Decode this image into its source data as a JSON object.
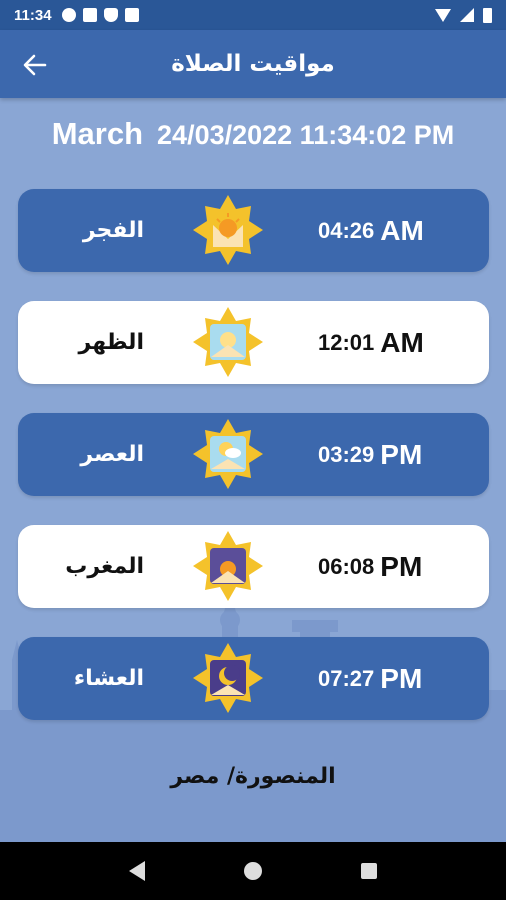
{
  "status_bar": {
    "time": "11:34"
  },
  "header": {
    "title": "مواقيت الصلاة"
  },
  "date": {
    "month": "March",
    "datetime": "24/03/2022 11:34:02 PM"
  },
  "prayers": [
    {
      "name": "الفجر",
      "time": "04:26",
      "period": "AM",
      "icon": "sunrise-icon"
    },
    {
      "name": "الظهر",
      "time": "12:01",
      "period": "AM",
      "icon": "sun-icon"
    },
    {
      "name": "العصر",
      "time": "03:29",
      "period": "PM",
      "icon": "sun-cloud-icon"
    },
    {
      "name": "المغرب",
      "time": "06:08",
      "period": "PM",
      "icon": "sunset-icon"
    },
    {
      "name": "العشاء",
      "time": "07:27",
      "period": "PM",
      "icon": "moon-icon"
    }
  ],
  "location": {
    "text": "المنصورة/ مصر"
  },
  "colors": {
    "primary": "#3c68ad",
    "background": "#8aa6d4",
    "status": "#2a5797",
    "star": "#f4c22b"
  }
}
